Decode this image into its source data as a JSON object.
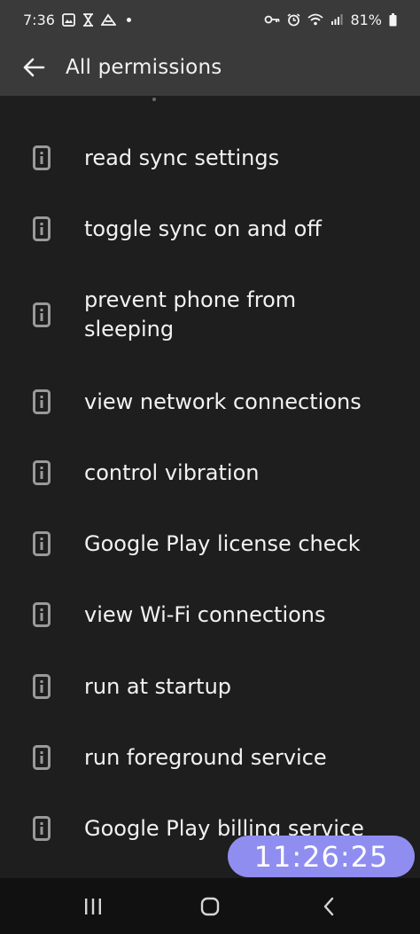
{
  "status_bar": {
    "time": "7:36",
    "battery": "81%",
    "icons_left": [
      "image-icon",
      "hourglass-icon",
      "app-icon",
      "dot-icon"
    ],
    "icons_right": [
      "vpn-key-icon",
      "alarm-icon",
      "wifi-icon",
      "signal-icon",
      "battery-icon"
    ]
  },
  "app_bar": {
    "title": "All permissions",
    "back_icon": "arrow-left-icon"
  },
  "permissions": [
    {
      "label": "read sync settings",
      "icon": "info-phone-icon"
    },
    {
      "label": "toggle sync on and off",
      "icon": "info-phone-icon"
    },
    {
      "label": "prevent phone from sleeping",
      "icon": "info-phone-icon"
    },
    {
      "label": "view network connections",
      "icon": "info-phone-icon"
    },
    {
      "label": "control vibration",
      "icon": "info-phone-icon"
    },
    {
      "label": "Google Play license check",
      "icon": "info-phone-icon"
    },
    {
      "label": "view Wi-Fi connections",
      "icon": "info-phone-icon"
    },
    {
      "label": "run at startup",
      "icon": "info-phone-icon"
    },
    {
      "label": "run foreground service",
      "icon": "info-phone-icon"
    },
    {
      "label": "Google Play billing service",
      "icon": "info-phone-icon"
    }
  ],
  "timer": {
    "value": "11:26:25"
  },
  "nav_bar": {
    "buttons": [
      "recent-apps-icon",
      "home-icon",
      "back-icon"
    ]
  },
  "colors": {
    "background": "#1e1e1e",
    "app_bar": "#3a3a3a",
    "nav_bar": "#111111",
    "timer_badge": "#8f8ef0",
    "icon_gray": "#9a9a9a"
  }
}
